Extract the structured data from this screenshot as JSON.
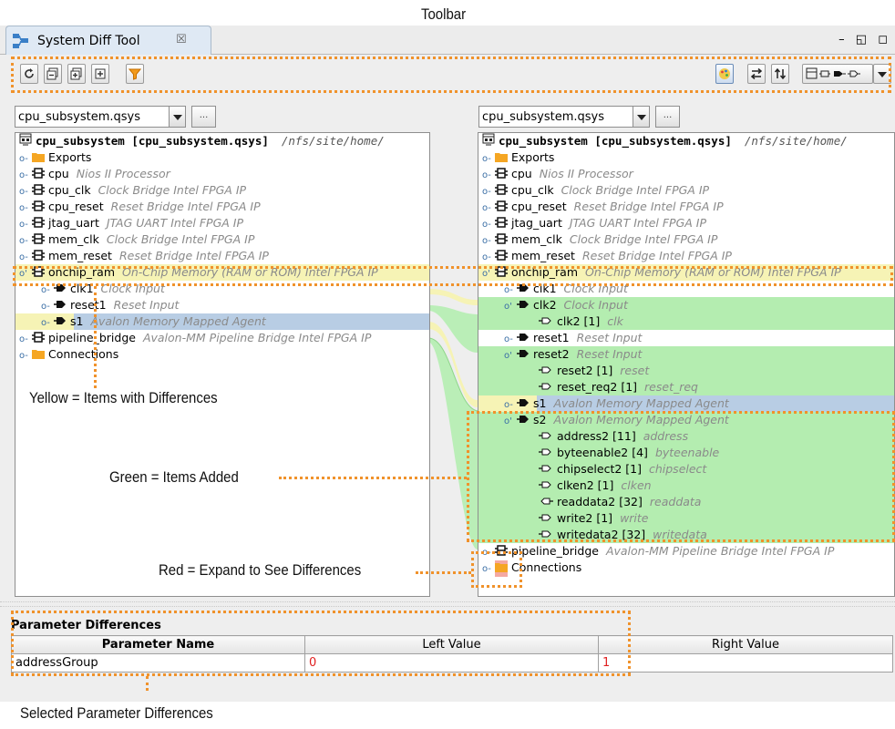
{
  "annotations": {
    "toolbar": "Toolbar",
    "yellow": "Yellow = Items with Differences",
    "green": "Green = Items Added",
    "red": "Red = Expand to See Differences",
    "selected_params": "Selected Parameter Differences"
  },
  "window": {
    "tab_title": "System Diff Tool",
    "tab_close": "☒",
    "controls": "–  ◱  ◻"
  },
  "colors": {
    "yellow_highlight": "#f6f3b5",
    "green_added": "#b4edb0",
    "selected_blue": "#b8cde4",
    "red_expand": "#f4a9a2",
    "callout_orange": "#f0922b"
  },
  "left": {
    "file": "cpu_subsystem.qsys",
    "browse": "...",
    "root_name": "cpu_subsystem [cpu_subsystem.qsys]",
    "root_path": "/nfs/site/home/",
    "rows": [
      {
        "label": "Exports",
        "desc": ""
      },
      {
        "label": "cpu",
        "desc": "Nios II Processor"
      },
      {
        "label": "cpu_clk",
        "desc": "Clock Bridge Intel FPGA IP"
      },
      {
        "label": "cpu_reset",
        "desc": "Reset Bridge Intel FPGA IP"
      },
      {
        "label": "jtag_uart",
        "desc": "JTAG UART Intel FPGA IP"
      },
      {
        "label": "mem_clk",
        "desc": "Clock Bridge Intel FPGA IP"
      },
      {
        "label": "mem_reset",
        "desc": "Reset Bridge Intel FPGA IP"
      },
      {
        "label": "onchip_ram",
        "desc": "On-Chip Memory (RAM or ROM) Intel FPGA IP"
      },
      {
        "label": "clk1",
        "desc": "Clock Input"
      },
      {
        "label": "reset1",
        "desc": "Reset Input"
      },
      {
        "label": "s1",
        "desc": "Avalon Memory Mapped Agent"
      },
      {
        "label": "pipeline_bridge",
        "desc": "Avalon-MM Pipeline Bridge Intel FPGA IP"
      },
      {
        "label": "Connections",
        "desc": ""
      }
    ]
  },
  "right": {
    "file": "cpu_subsystem.qsys",
    "browse": "...",
    "root_name": "cpu_subsystem [cpu_subsystem.qsys]",
    "root_path": "/nfs/site/home/",
    "rows": [
      {
        "label": "Exports",
        "desc": ""
      },
      {
        "label": "cpu",
        "desc": "Nios II Processor"
      },
      {
        "label": "cpu_clk",
        "desc": "Clock Bridge Intel FPGA IP"
      },
      {
        "label": "cpu_reset",
        "desc": "Reset Bridge Intel FPGA IP"
      },
      {
        "label": "jtag_uart",
        "desc": "JTAG UART Intel FPGA IP"
      },
      {
        "label": "mem_clk",
        "desc": "Clock Bridge Intel FPGA IP"
      },
      {
        "label": "mem_reset",
        "desc": "Reset Bridge Intel FPGA IP"
      },
      {
        "label": "onchip_ram",
        "desc": "On-Chip Memory (RAM or ROM) Intel FPGA IP"
      },
      {
        "label": "clk1",
        "desc": "Clock Input"
      },
      {
        "label": "clk2",
        "desc": "Clock Input"
      },
      {
        "label": "clk2 [1]",
        "desc": "clk"
      },
      {
        "label": "reset1",
        "desc": "Reset Input"
      },
      {
        "label": "reset2",
        "desc": "Reset Input"
      },
      {
        "label": "reset2 [1]",
        "desc": "reset"
      },
      {
        "label": "reset_req2 [1]",
        "desc": "reset_req"
      },
      {
        "label": "s1",
        "desc": "Avalon Memory Mapped Agent"
      },
      {
        "label": "s2",
        "desc": "Avalon Memory Mapped Agent"
      },
      {
        "label": "address2 [11]",
        "desc": "address"
      },
      {
        "label": "byteenable2 [4]",
        "desc": "byteenable"
      },
      {
        "label": "chipselect2 [1]",
        "desc": "chipselect"
      },
      {
        "label": "clken2 [1]",
        "desc": "clken"
      },
      {
        "label": "readdata2 [32]",
        "desc": "readdata"
      },
      {
        "label": "write2 [1]",
        "desc": "write"
      },
      {
        "label": "writedata2 [32]",
        "desc": "writedata"
      },
      {
        "label": "pipeline_bridge",
        "desc": "Avalon-MM Pipeline Bridge Intel FPGA IP"
      },
      {
        "label": "Connections",
        "desc": ""
      }
    ]
  },
  "params": {
    "title": "Parameter Differences",
    "headers": [
      "Parameter Name",
      "Left Value",
      "Right Value"
    ],
    "rows": [
      {
        "name": "addressGroup",
        "left": "0",
        "right": "1"
      }
    ]
  }
}
